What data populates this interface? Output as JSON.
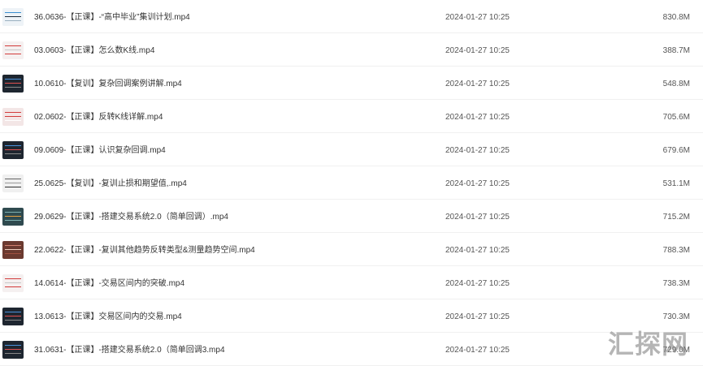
{
  "files": [
    {
      "name": "36.0636-【正课】-“高中毕业”集训计划.mp4",
      "date": "2024-01-27 10:25",
      "size": "830.8M",
      "thumb": "light-blue"
    },
    {
      "name": "03.0603-【正课】怎么数K线.mp4",
      "date": "2024-01-27 10:25",
      "size": "388.7M",
      "thumb": "light-red"
    },
    {
      "name": "10.0610-【复训】复杂回调案例讲解.mp4",
      "date": "2024-01-27 10:25",
      "size": "548.8M",
      "thumb": "dark"
    },
    {
      "name": "02.0602-【正课】反转K线详解.mp4",
      "date": "2024-01-27 10:25",
      "size": "705.6M",
      "thumb": "red"
    },
    {
      "name": "09.0609-【正课】认识复杂回调.mp4",
      "date": "2024-01-27 10:25",
      "size": "679.6M",
      "thumb": "dark"
    },
    {
      "name": "25.0625-【复训】-复训止损和期望值,.mp4",
      "date": "2024-01-27 10:25",
      "size": "531.1M",
      "thumb": "light-grey"
    },
    {
      "name": "29.0629-【正课】-搭建交易系统2.0（简单回调）.mp4",
      "date": "2024-01-27 10:25",
      "size": "715.2M",
      "thumb": "teal"
    },
    {
      "name": "22.0622-【正课】-复训其他趋势反转类型&测量趋势空间.mp4",
      "date": "2024-01-27 10:25",
      "size": "788.3M",
      "thumb": "brown"
    },
    {
      "name": "14.0614-【正课】-交易区间内的突破.mp4",
      "date": "2024-01-27 10:25",
      "size": "738.3M",
      "thumb": "light-red"
    },
    {
      "name": "13.0613-【正课】交易区间内的交易.mp4",
      "date": "2024-01-27 10:25",
      "size": "730.3M",
      "thumb": "dark"
    },
    {
      "name": "31.0631-【正课】-搭建交易系统2.0（简单回调3.mp4",
      "date": "2024-01-27 10:25",
      "size": "729.0M",
      "thumb": "dark"
    }
  ],
  "colors": {
    "text": "#333333",
    "meta_text": "#555555",
    "row_divider": "#f0f0f0",
    "thumb_dark": "#1e2630",
    "thumb_light": "#f2f2f2",
    "thumb_red": "#d33b3b",
    "thumb_teal": "#2f4a4f",
    "thumb_brown": "#6b3a30"
  },
  "watermark": "汇探网"
}
